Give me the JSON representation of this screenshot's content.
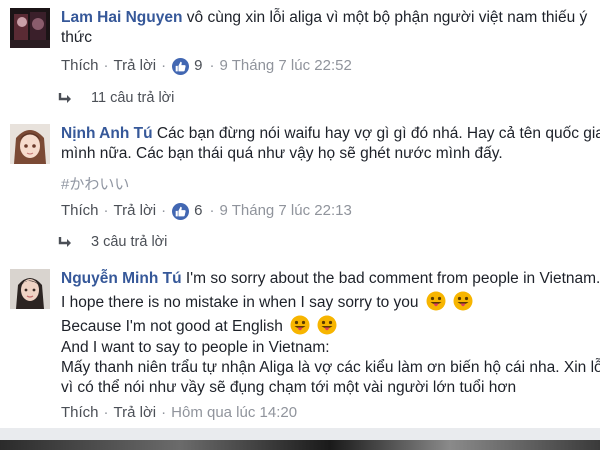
{
  "comments": [
    {
      "author": "Lam Hai Nguyen",
      "lines": [
        "vô cùng xin lỗi aliga vì một bộ phận người việt nam thiếu ý",
        "thức"
      ],
      "actions": {
        "like_label": "Thích",
        "reply_label": "Trả lời",
        "like_count": "9",
        "timestamp": "9 Tháng 7 lúc 22:52"
      },
      "replies_label": "11 câu trả lời"
    },
    {
      "author": "Nịnh Anh Tú",
      "lines": [
        "Các bạn đừng nói waifu hay vợ gì gì đó nhá. Hay cả tên quốc gia",
        "mình nữa. Các bạn thái quá như vậy họ sẽ ghét nước mình đấy."
      ],
      "hashtag": "#かわいい",
      "actions": {
        "like_label": "Thích",
        "reply_label": "Trả lời",
        "like_count": "6",
        "timestamp": "9 Tháng 7 lúc 22:13"
      },
      "replies_label": "3 câu trả lời"
    },
    {
      "author": "Nguyễn Minh Tú",
      "lines": [
        "I'm so sorry about the bad comment from people in Vietnam.",
        "I hope there is no mistake in when I say sorry to you",
        "Because I'm not good at English",
        "And I want to say to people in Vietnam:",
        "Mấy thanh niên trẩu tự nhận Aliga là vợ các kiểu làm ơn biến hộ cái nha. Xin lỗi",
        "vì có thể nói như vầy sẽ đụng chạm tới một vài người lớn tuổi hơn"
      ],
      "actions": {
        "like_label": "Thích",
        "reply_label": "Trả lời",
        "timestamp": "Hôm qua lúc 14:20"
      }
    }
  ],
  "icons": {
    "like": "thumbs-up-icon",
    "reply_arrow": "reply-arrow-icon",
    "emoji": "grinning-tongue-emoji-icon"
  },
  "colors": {
    "author": "#365899",
    "like_badge": "#4267b2",
    "meta": "#90949c",
    "emoji": "#f7b500"
  }
}
